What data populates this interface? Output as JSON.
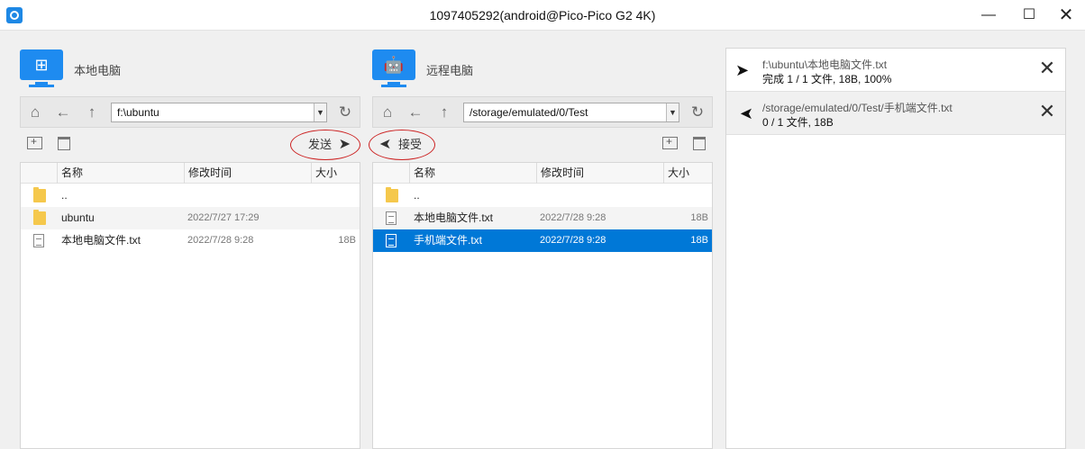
{
  "window": {
    "title": "1097405292(android@Pico-Pico G2 4K)",
    "minimize": "—",
    "maximize": "☐",
    "close": "✕"
  },
  "local": {
    "title": "本地电脑",
    "icon": "windows-logo-icon",
    "path": "f:\\ubuntu",
    "action_label": "发送",
    "columns": [
      "名称",
      "修改时间",
      "大小"
    ],
    "rows": [
      {
        "type": "folder",
        "name": "..",
        "time": "",
        "size": ""
      },
      {
        "type": "folder",
        "name": "ubuntu",
        "time": "2022/7/27 17:29",
        "size": ""
      },
      {
        "type": "file",
        "name": "本地电脑文件.txt",
        "time": "2022/7/28 9:28",
        "size": "18B"
      }
    ]
  },
  "remote": {
    "title": "远程电脑",
    "icon": "android-logo-icon",
    "path": "/storage/emulated/0/Test",
    "action_label": "接受",
    "columns": [
      "名称",
      "修改时间",
      "大小"
    ],
    "rows": [
      {
        "type": "folder",
        "name": "..",
        "time": "",
        "size": ""
      },
      {
        "type": "file",
        "name": "本地电脑文件.txt",
        "time": "2022/7/28 9:28",
        "size": "18B"
      },
      {
        "type": "file",
        "name": "手机端文件.txt",
        "time": "2022/7/28 9:28",
        "size": "18B",
        "selected": true
      }
    ]
  },
  "transfers": [
    {
      "direction": "send",
      "path": "f:\\ubuntu\\本地电脑文件.txt",
      "status": "完成 1 / 1 文件, 18B, 100%"
    },
    {
      "direction": "receive",
      "path": "/storage/emulated/0/Test/手机端文件.txt",
      "status": "0 / 1 文件, 18B"
    }
  ],
  "colors": {
    "accent": "#1e8bf0",
    "selection": "#0078d7",
    "annotation_ring": "#cc2222"
  }
}
